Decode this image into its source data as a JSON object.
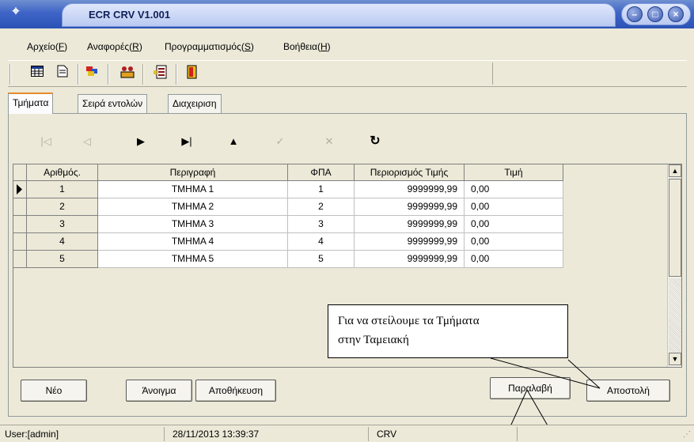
{
  "window": {
    "title": "ECR CRV V1.001"
  },
  "menu": [
    {
      "label": "Αρχείο",
      "key": "F"
    },
    {
      "label": "Αναφορές",
      "key": "R"
    },
    {
      "label": "Προγραμματισμός",
      "key": "S"
    },
    {
      "label": "Βοήθεια",
      "key": "H"
    }
  ],
  "toolbar_icons": [
    "table-icon",
    "document-icon",
    "palette-icon",
    "network-icon",
    "list-export-icon",
    "exit-door-icon"
  ],
  "tabs": [
    "Τμήματα",
    "Σειρά εντολών",
    "Διαχειριση"
  ],
  "navigator_icons": [
    "first-record-icon",
    "prior-record-icon",
    "next-record-icon",
    "last-record-icon",
    "insert-record-icon",
    "post-record-icon",
    "cancel-edit-icon",
    "refresh-icon"
  ],
  "grid": {
    "columns": [
      "Αριθμός.",
      "Περιγραφή",
      "ΦΠΑ",
      "Περιορισμός Τιμής",
      "Τιμή"
    ],
    "rows": [
      [
        "1",
        "ΤΜΗΜΑ 1",
        "1",
        "9999999,99",
        "0,00"
      ],
      [
        "2",
        "ΤΜΗΜΑ 2",
        "2",
        "9999999,99",
        "0,00"
      ],
      [
        "3",
        "ΤΜΗΜΑ 3",
        "3",
        "9999999,99",
        "0,00"
      ],
      [
        "4",
        "ΤΜΗΜΑ 4",
        "4",
        "9999999,99",
        "0,00"
      ],
      [
        "5",
        "ΤΜΗΜΑ 5",
        "5",
        "9999999,99",
        "0,00"
      ]
    ]
  },
  "buttons": {
    "new": "Νέο",
    "open": "Άνοιγμα",
    "save": "Αποθήκευση",
    "receive": "Παραλαβή",
    "send": "Αποστολή"
  },
  "callout": {
    "line1": "Για να στείλουμε τα  Τμήματα",
    "line2": "στην Ταμειακή"
  },
  "status": {
    "user": "User:[admin]",
    "datetime": "28/11/2013 13:39:37",
    "mode": "CRV"
  }
}
